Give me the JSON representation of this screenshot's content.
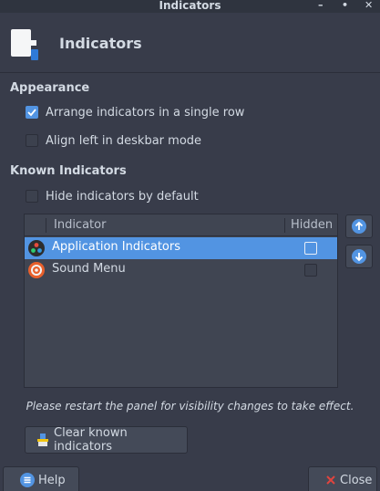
{
  "window": {
    "title": "Indicators"
  },
  "header": {
    "title": "Indicators"
  },
  "appearance": {
    "title": "Appearance",
    "single_row": {
      "label": "Arrange indicators in a single row",
      "checked": true
    },
    "align_left": {
      "label": "Align left in deskbar mode",
      "checked": false
    }
  },
  "known": {
    "title": "Known Indicators",
    "hide_default": {
      "label": "Hide indicators by default",
      "checked": false
    },
    "columns": {
      "indicator": "Indicator",
      "hidden": "Hidden"
    },
    "rows": [
      {
        "label": "Application Indicators",
        "hidden": false,
        "selected": true,
        "icon": "application-indicators-icon"
      },
      {
        "label": "Sound Menu",
        "hidden": false,
        "selected": false,
        "icon": "sound-menu-icon"
      }
    ],
    "note": "Please restart the panel for visibility changes to take effect.",
    "clear_label": "Clear known indicators"
  },
  "footer": {
    "help_label": "Help",
    "close_label": "Close"
  },
  "colors": {
    "accent": "#5294e2",
    "background": "#383c4a",
    "close_x": "#e0443e"
  }
}
